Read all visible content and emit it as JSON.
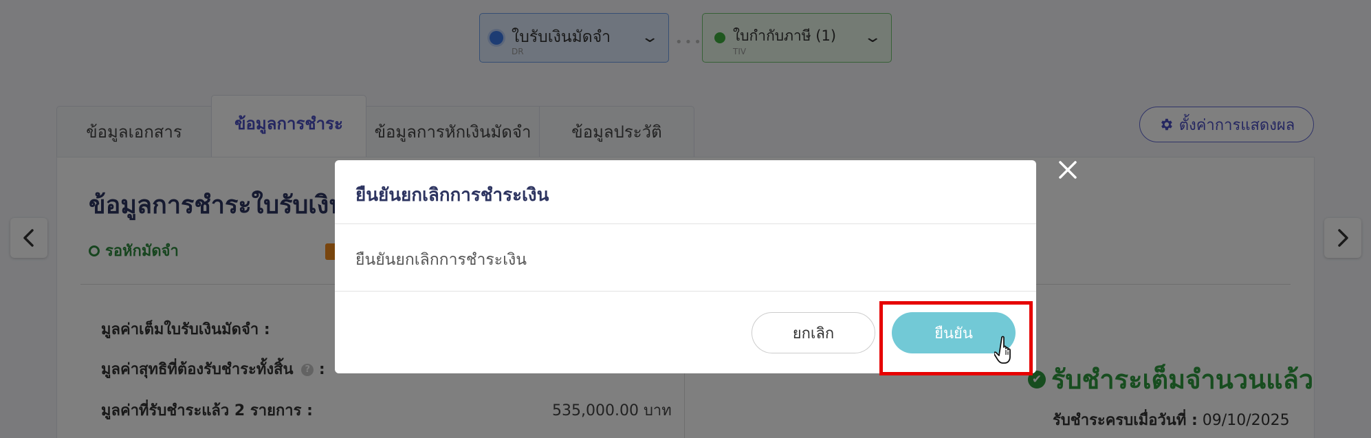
{
  "doc_flow": {
    "items": [
      {
        "label": "ใบรับเงินมัดจำ",
        "code": "DR"
      },
      {
        "label": "ใบกำกับภาษี (1)",
        "code": "TIV"
      }
    ]
  },
  "tabs": [
    "ข้อมูลเอกสาร",
    "ข้อมูลการชำระ",
    "ข้อมูลการหักเงินมัดจำ",
    "ข้อมูลประวัติ"
  ],
  "settings_label": "ตั้งค่าการแสดงผล",
  "panel": {
    "title": "ข้อมูลการชำระใบรับเงินม",
    "status": "รอหักมัดจำ",
    "rows": [
      {
        "label": "มูลค่าเต็มใบรับเงินมัดจำ :"
      },
      {
        "label": "มูลค่าสุทธิที่ต้องรับชำระทั้งสิ้น",
        "suffix": ":"
      },
      {
        "label": "มูลค่าที่รับชำระแล้ว 2 รายการ :",
        "value": "535,000.00 บาท"
      }
    ],
    "paid_status": "รับชำระเต็มจำนวนแล้ว",
    "paid_date_label": "รับชำระครบเมื่อวันที่ :",
    "paid_date_value": "09/10/2025"
  },
  "modal": {
    "title": "ยืนยันยกเลิกการชำระเงิน",
    "body": "ยืนยันยกเลิกการชำระเงิน",
    "cancel_label": "ยกเลิก",
    "confirm_label": "ยืนยัน"
  },
  "colors": {
    "accent": "#4a4ec3",
    "confirm": "#72c9d6",
    "success": "#2e9a3e",
    "highlight": "#e60000"
  }
}
